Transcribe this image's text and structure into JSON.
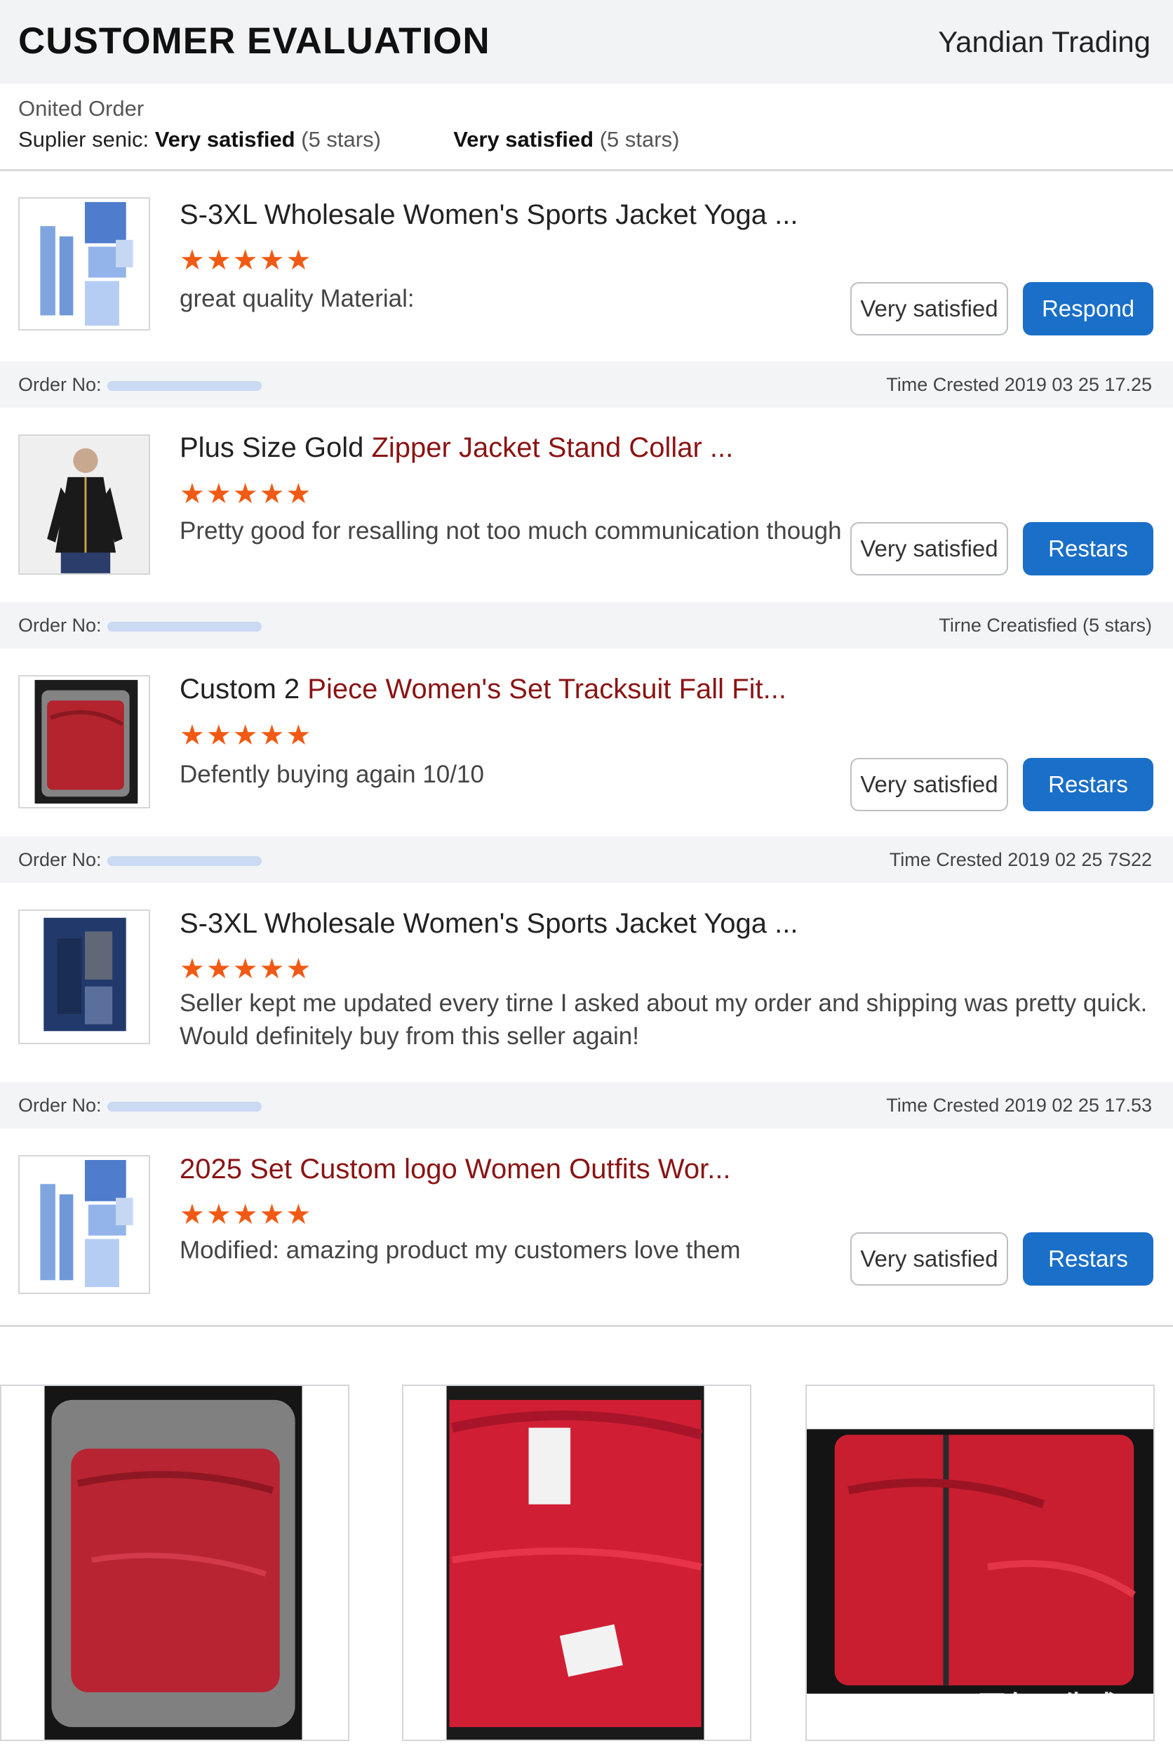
{
  "header": {
    "title": "CUSTOMER EVALUATION",
    "company": "Yandian Trading"
  },
  "summary": {
    "line1": "Onited Order",
    "supplier_prefix": "Suplier senic: ",
    "supplier_value": "Very satisfied",
    "supplier_stars": "(5 stars)",
    "overall_value": "Very satisfied",
    "overall_stars": "(5 stars)"
  },
  "reviews": [
    {
      "title_plain": "S-3XL Wholesale Women's Sports Jacket Yoga ...",
      "title_red": "",
      "stars": "★★★★★",
      "text": "great quality Material:",
      "satisfaction": "Very satisfied",
      "action": "Respond",
      "image_icon": "blue-leggings-icon"
    },
    {
      "title_plain": "Plus Size Gold ",
      "title_red": "Zipper Jacket Stand Collar ...",
      "stars": "★★★★★",
      "text": "Pretty good for resalling not too much communication though",
      "satisfaction": "Very satisfied",
      "action": "Restars",
      "image_icon": "black-jacket-model-icon"
    },
    {
      "title_plain": "Custom 2 ",
      "title_red": "Piece Women's Set Tracksuit Fall Fit...",
      "stars": "★★★★★",
      "text": "Defently buying again 10/10",
      "satisfaction": "Very satisfied",
      "action": "Restars",
      "image_icon": "red-tracksuit-bag-icon"
    },
    {
      "title_plain": "S-3XL Wholesale Women's Sports Jacket Yoga ...",
      "title_red": "",
      "stars": "★★★★★",
      "text": "Seller kept me updated every tirne I asked about my order and shipping was pretty quick. Would definitely buy from this seller again!",
      "satisfaction": "",
      "action": "",
      "image_icon": "navy-jacket-icon"
    },
    {
      "title_plain": "",
      "title_red": "2025 Set Custom logo Women Outfits Wor...",
      "stars": "★★★★★",
      "text": "Modified: amazing product my customers love them",
      "satisfaction": "Very satisfied",
      "action": "Restars",
      "image_icon": "blue-leggings-icon"
    }
  ],
  "order_rows": [
    {
      "label": "Order No:",
      "time": "Time Crested 2019 03 25 17.25"
    },
    {
      "label": "Order No:",
      "time": "Tirne Creatisfied  (5 stars)"
    },
    {
      "label": "Order No:",
      "time": "Time Crested 2019 02 25 7S22"
    },
    {
      "label": "Order No:",
      "time": "Time Crested 2019 02 25 17.53"
    }
  ],
  "gallery": {
    "images": [
      "red-tracksuit-in-bag-photo",
      "red-jacket-with-tags-photo",
      "red-jacket-spread-photo"
    ],
    "watermark": "豆包AI生成"
  },
  "colors": {
    "accent_blue": "#1a6fc8",
    "star_orange": "#f05a14",
    "title_red": "#8a1414"
  }
}
